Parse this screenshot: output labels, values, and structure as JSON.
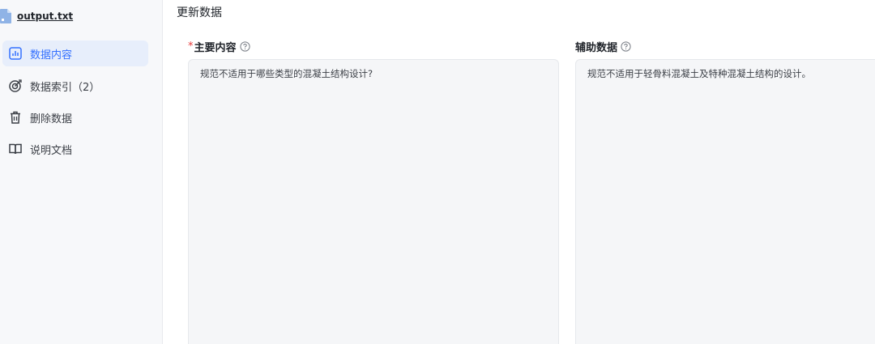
{
  "sidebar": {
    "file_name": "output.txt",
    "items": [
      {
        "label": "数据内容",
        "icon": "bar-chart-icon",
        "active": true
      },
      {
        "label": "数据索引（2）",
        "icon": "target-index-icon",
        "active": false
      },
      {
        "label": "删除数据",
        "icon": "trash-icon",
        "active": false
      },
      {
        "label": "说明文档",
        "icon": "book-icon",
        "active": false
      }
    ]
  },
  "main": {
    "title": "更新数据",
    "primary": {
      "required_mark": "*",
      "label": "主要内容",
      "value": "规范不适用于哪些类型的混凝土结构设计?"
    },
    "secondary": {
      "label": "辅助数据",
      "value": "规范不适用于轻骨料混凝土及特种混凝土结构的设计。"
    }
  },
  "colors": {
    "accent": "#3370ff",
    "active_bg": "#e7eefb",
    "required": "#e63b3b",
    "field_bg": "#f5f6f8"
  }
}
